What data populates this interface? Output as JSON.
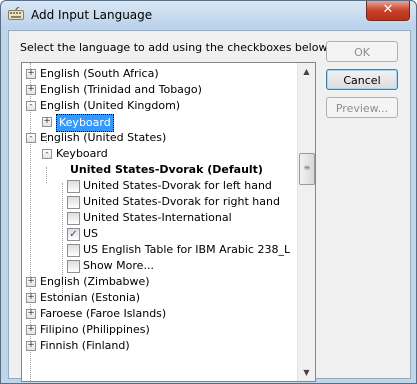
{
  "window": {
    "title": "Add Input Language",
    "close_glyph": "✕"
  },
  "instruction": "Select the language to add using the checkboxes below.",
  "buttons": {
    "ok": "OK",
    "cancel": "Cancel",
    "preview": "Preview..."
  },
  "tree": {
    "items": [
      {
        "label": "English (South Africa)",
        "expander": "+"
      },
      {
        "label": "English (Trinidad and Tobago)",
        "expander": "+"
      },
      {
        "label": "English (United Kingdom)",
        "expander": "-"
      },
      {
        "label": "Keyboard",
        "expander": "+",
        "selected": true
      },
      {
        "label": "English (United States)",
        "expander": "-"
      },
      {
        "label": "Keyboard",
        "expander": "-"
      },
      {
        "label": "United States-Dvorak (Default)",
        "bold": true
      },
      {
        "label": "United States-Dvorak for left hand",
        "checked": false
      },
      {
        "label": "United States-Dvorak for right hand",
        "checked": false
      },
      {
        "label": "United States-International",
        "checked": false
      },
      {
        "label": "US",
        "checked": true
      },
      {
        "label": "US English Table for IBM Arabic 238_L",
        "checked": false
      },
      {
        "label": "Show More...",
        "checked": false
      },
      {
        "label": "English (Zimbabwe)",
        "expander": "+"
      },
      {
        "label": "Estonian (Estonia)",
        "expander": "+"
      },
      {
        "label": "Faroese (Faroe Islands)",
        "expander": "+"
      },
      {
        "label": "Filipino (Philippines)",
        "expander": "+"
      },
      {
        "label": "Finnish (Finland)",
        "expander": "+"
      }
    ],
    "check_glyph": "✓"
  },
  "scrollbar": {
    "up_glyph": "▲",
    "down_glyph": "▼",
    "grip_glyph": "≡"
  }
}
